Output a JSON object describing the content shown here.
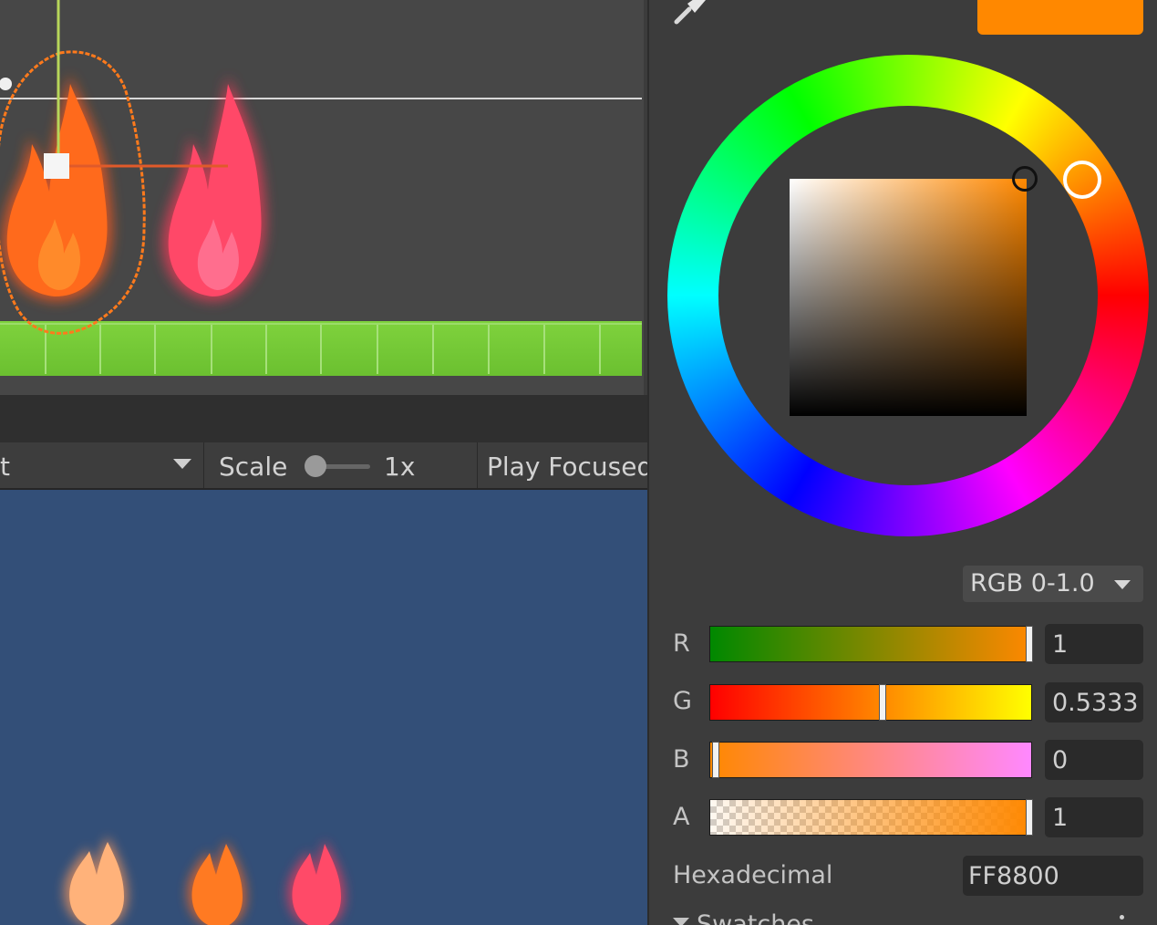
{
  "game_toolbar": {
    "left_dropdown_fragment": "t",
    "scale_label": "Scale",
    "scale_value": "1x",
    "play_focused_label": "Play Focused",
    "scale_slider_fraction": 0.0
  },
  "color_picker": {
    "swatch_color": "#FF8800",
    "mode_label": "RGB 0-1.0",
    "channels": [
      {
        "label": "R",
        "value": "1",
        "fraction": 1.0
      },
      {
        "label": "G",
        "value": "0.5333",
        "fraction": 0.5333
      },
      {
        "label": "B",
        "value": "0",
        "fraction": 0.0
      },
      {
        "label": "A",
        "value": "1",
        "fraction": 1.0
      }
    ],
    "hex_label": "Hexadecimal",
    "hex_value": "FF8800",
    "swatches_label": "Swatches"
  },
  "icons": [
    "eyedropper-icon",
    "dropdown-arrow-icon",
    "more-options-icon",
    "foldout-arrow-icon"
  ]
}
